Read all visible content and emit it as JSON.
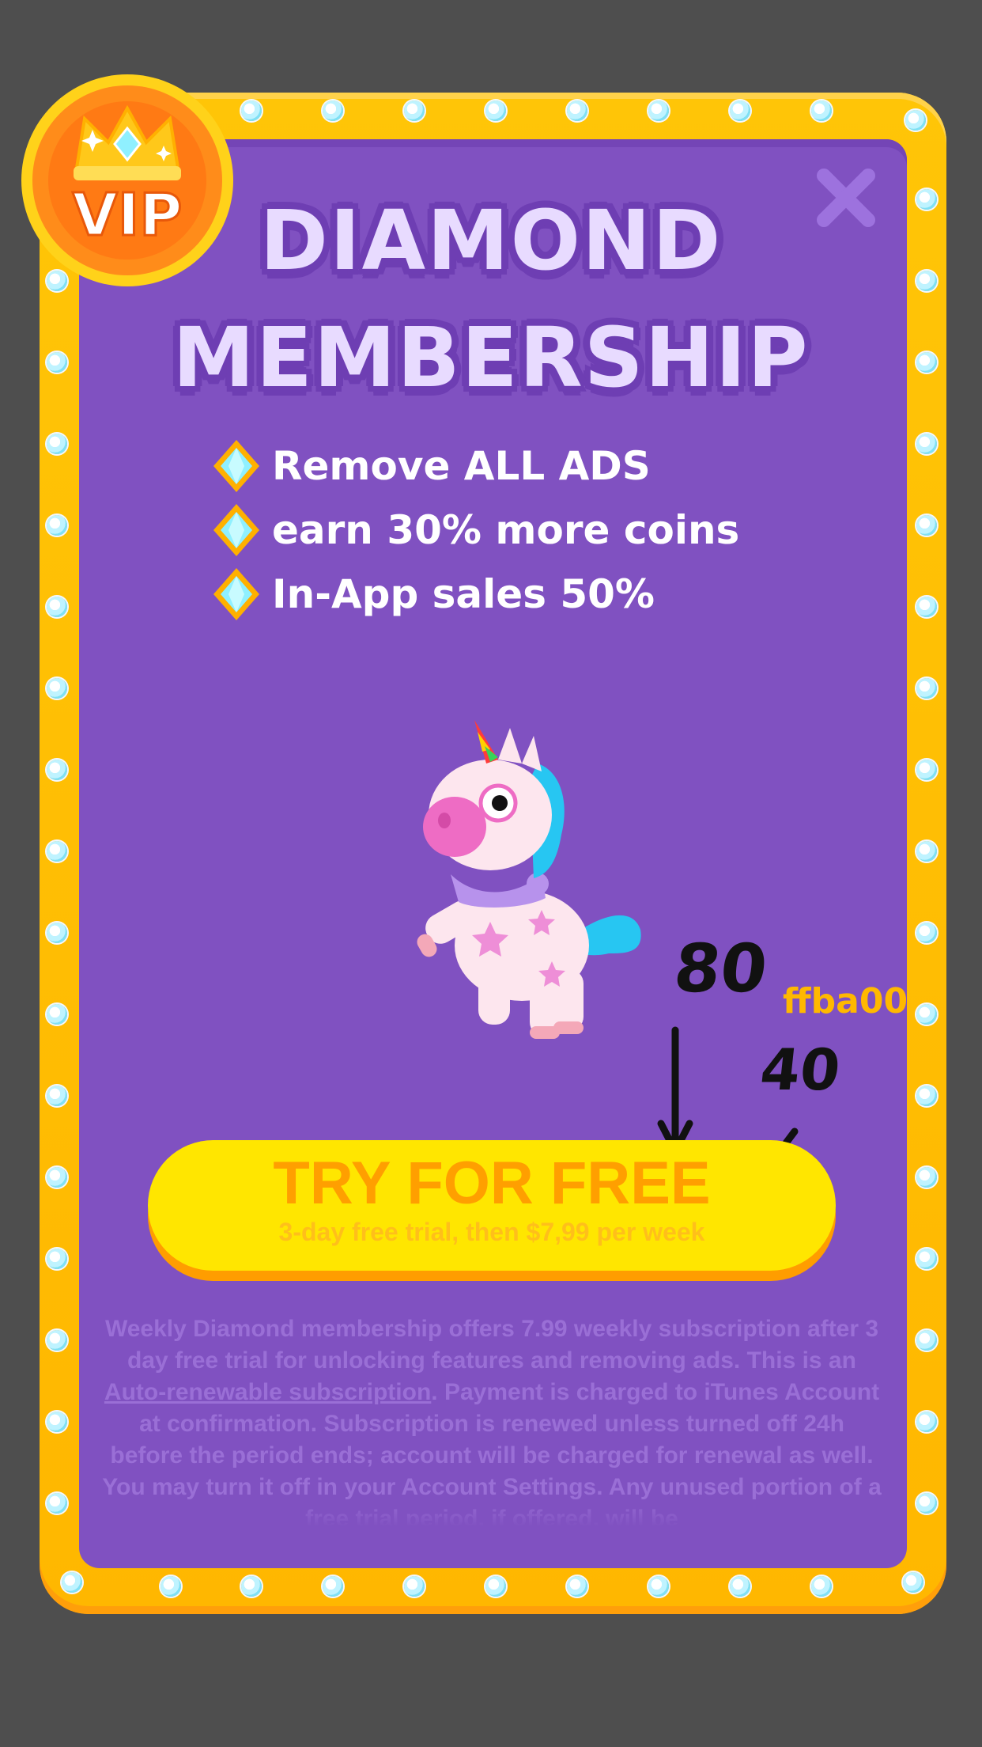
{
  "dialog": {
    "badge_label": "VIP",
    "title_line1": "DIAMOND",
    "title_line2": "MEMBERSHIP",
    "features": [
      {
        "text": "Remove ALL ADS",
        "icon": "diamond-icon"
      },
      {
        "text": "earn 30% more coins",
        "icon": "diamond-icon"
      },
      {
        "text": "In-App sales 50%",
        "icon": "diamond-icon"
      }
    ],
    "cta": {
      "label": "TRY FOR FREE",
      "sublabel": "3-day free trial, then $7,99 per week"
    },
    "legal": {
      "before_link": "Weekly Diamond membership offers 7.99 weekly subscription after 3 day free trial for unlocking features and removing ads. This is an ",
      "link": "Auto-renewable subscription",
      "after_link": ". Payment is charged to iTunes Account at confirmation. Subscription is renewed unless turned off 24h before the period ends; account will be charged for renewal as well. You may turn it off in your Account Settings. Any unused portion of a free trial period, if offered, will be"
    }
  },
  "annotations": {
    "height_label": "80",
    "radius_label": "40",
    "color_label": "ffba00"
  },
  "colors": {
    "frame": "#ffc107",
    "panel": "#8051c1",
    "button": "#ffe600",
    "button_text": "#ff9f00",
    "annotation_color": "#ffba00"
  }
}
